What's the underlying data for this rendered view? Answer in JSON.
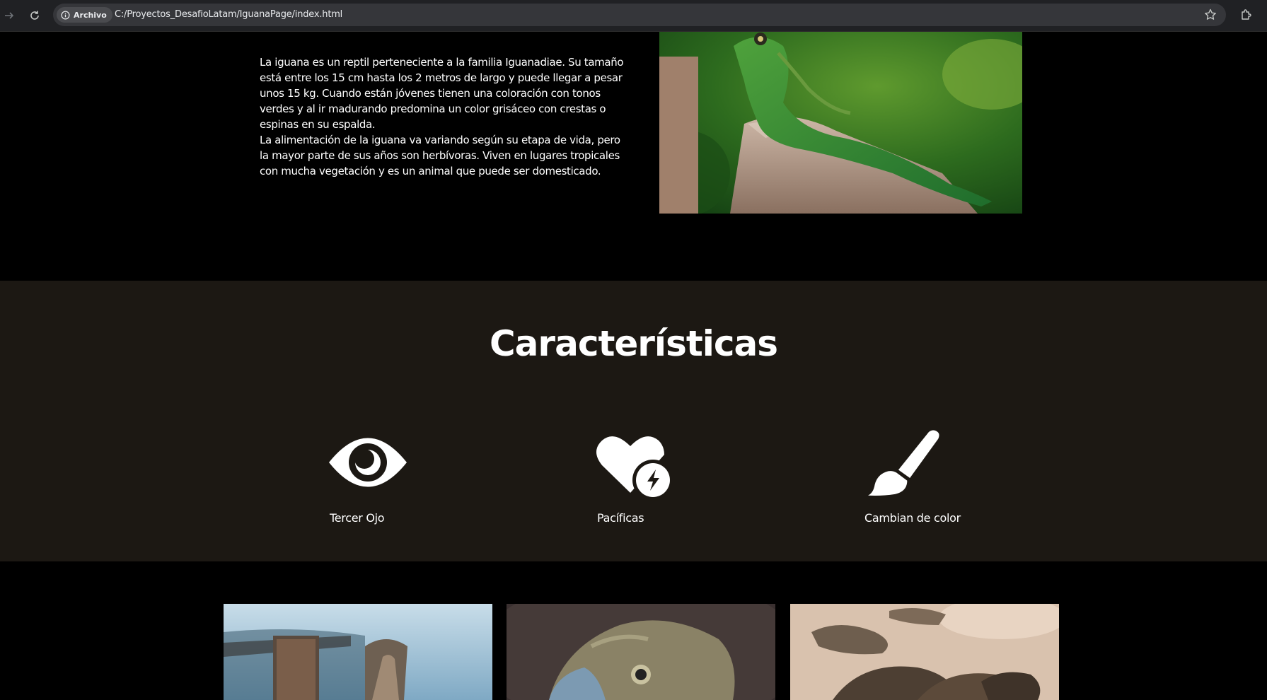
{
  "browser": {
    "chip_label": "Archivo",
    "url": "C:/Proyectos_DesafioLatam/IguanaPage/index.html"
  },
  "intro": {
    "paragraph1": "La iguana es un reptil perteneciente a la familia Iguanadiae. Su tamaño está entre los 15 cm hasta los 2 metros de largo y puede llegar a pesar unos 15 kg. Cuando están jóvenes tienen una coloración con tonos verdes y al ir madurando predomina un color grisáceo con crestas o espinas en su espalda.",
    "paragraph2": "La alimentación de la iguana va variando según su etapa de vida, pero la mayor parte de sus años son herbívoras. Viven en lugares tropicales con mucha vegetación y es un animal que puede ser domesticado."
  },
  "features": {
    "title": "Características",
    "items": [
      {
        "label": "Tercer Ojo",
        "icon": "eye-icon"
      },
      {
        "label": "Pacíficas",
        "icon": "heart-bolt-icon"
      },
      {
        "label": "Cambian de color",
        "icon": "paintbrush-icon"
      }
    ]
  },
  "colors": {
    "page_bg": "#000000",
    "features_bg": "#1c1813",
    "text": "#ffffff"
  }
}
